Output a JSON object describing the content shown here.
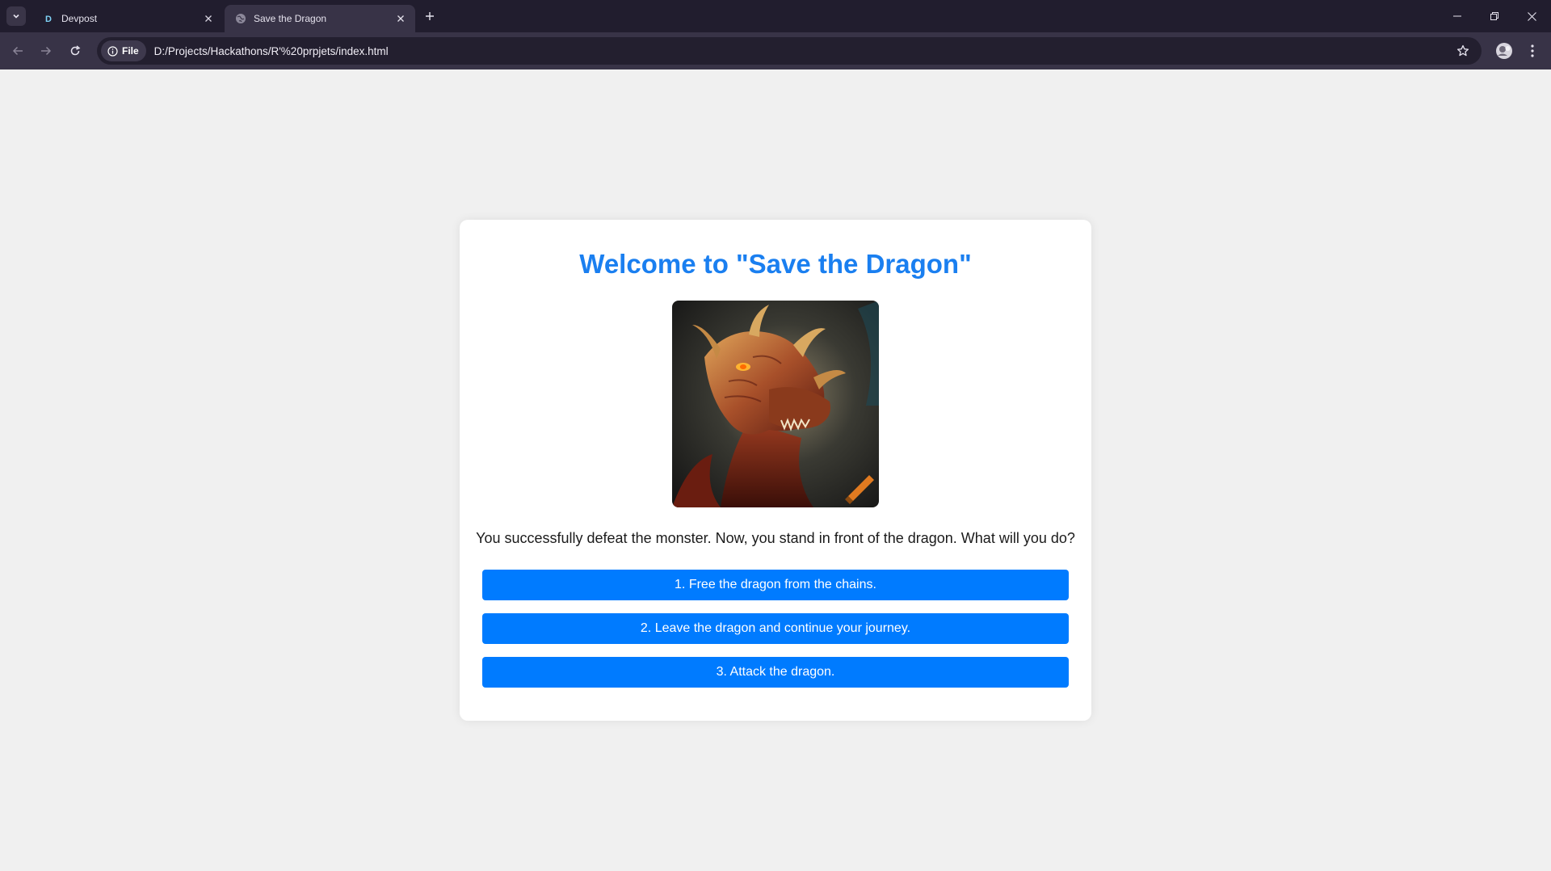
{
  "browser": {
    "tabs": [
      {
        "title": "Devpost",
        "favicon_letter": "D",
        "active": false
      },
      {
        "title": "Save the Dragon",
        "active": true
      }
    ],
    "site_chip": "File",
    "url": "D:/Projects/Hackathons/R'%20prpjets/index.html"
  },
  "game": {
    "title": "Welcome to \"Save the Dragon\"",
    "story": "You successfully defeat the monster. Now, you stand in front of the dragon. What will you do?",
    "choices": [
      "1. Free the dragon from the chains.",
      "2. Leave the dragon and continue your journey.",
      "3. Attack the dragon."
    ]
  },
  "colors": {
    "title": "#1a7ff0",
    "button": "#007bff",
    "page_bg": "#f0f0f0",
    "chrome_dark": "#211d2e",
    "toolbar": "#383347"
  }
}
